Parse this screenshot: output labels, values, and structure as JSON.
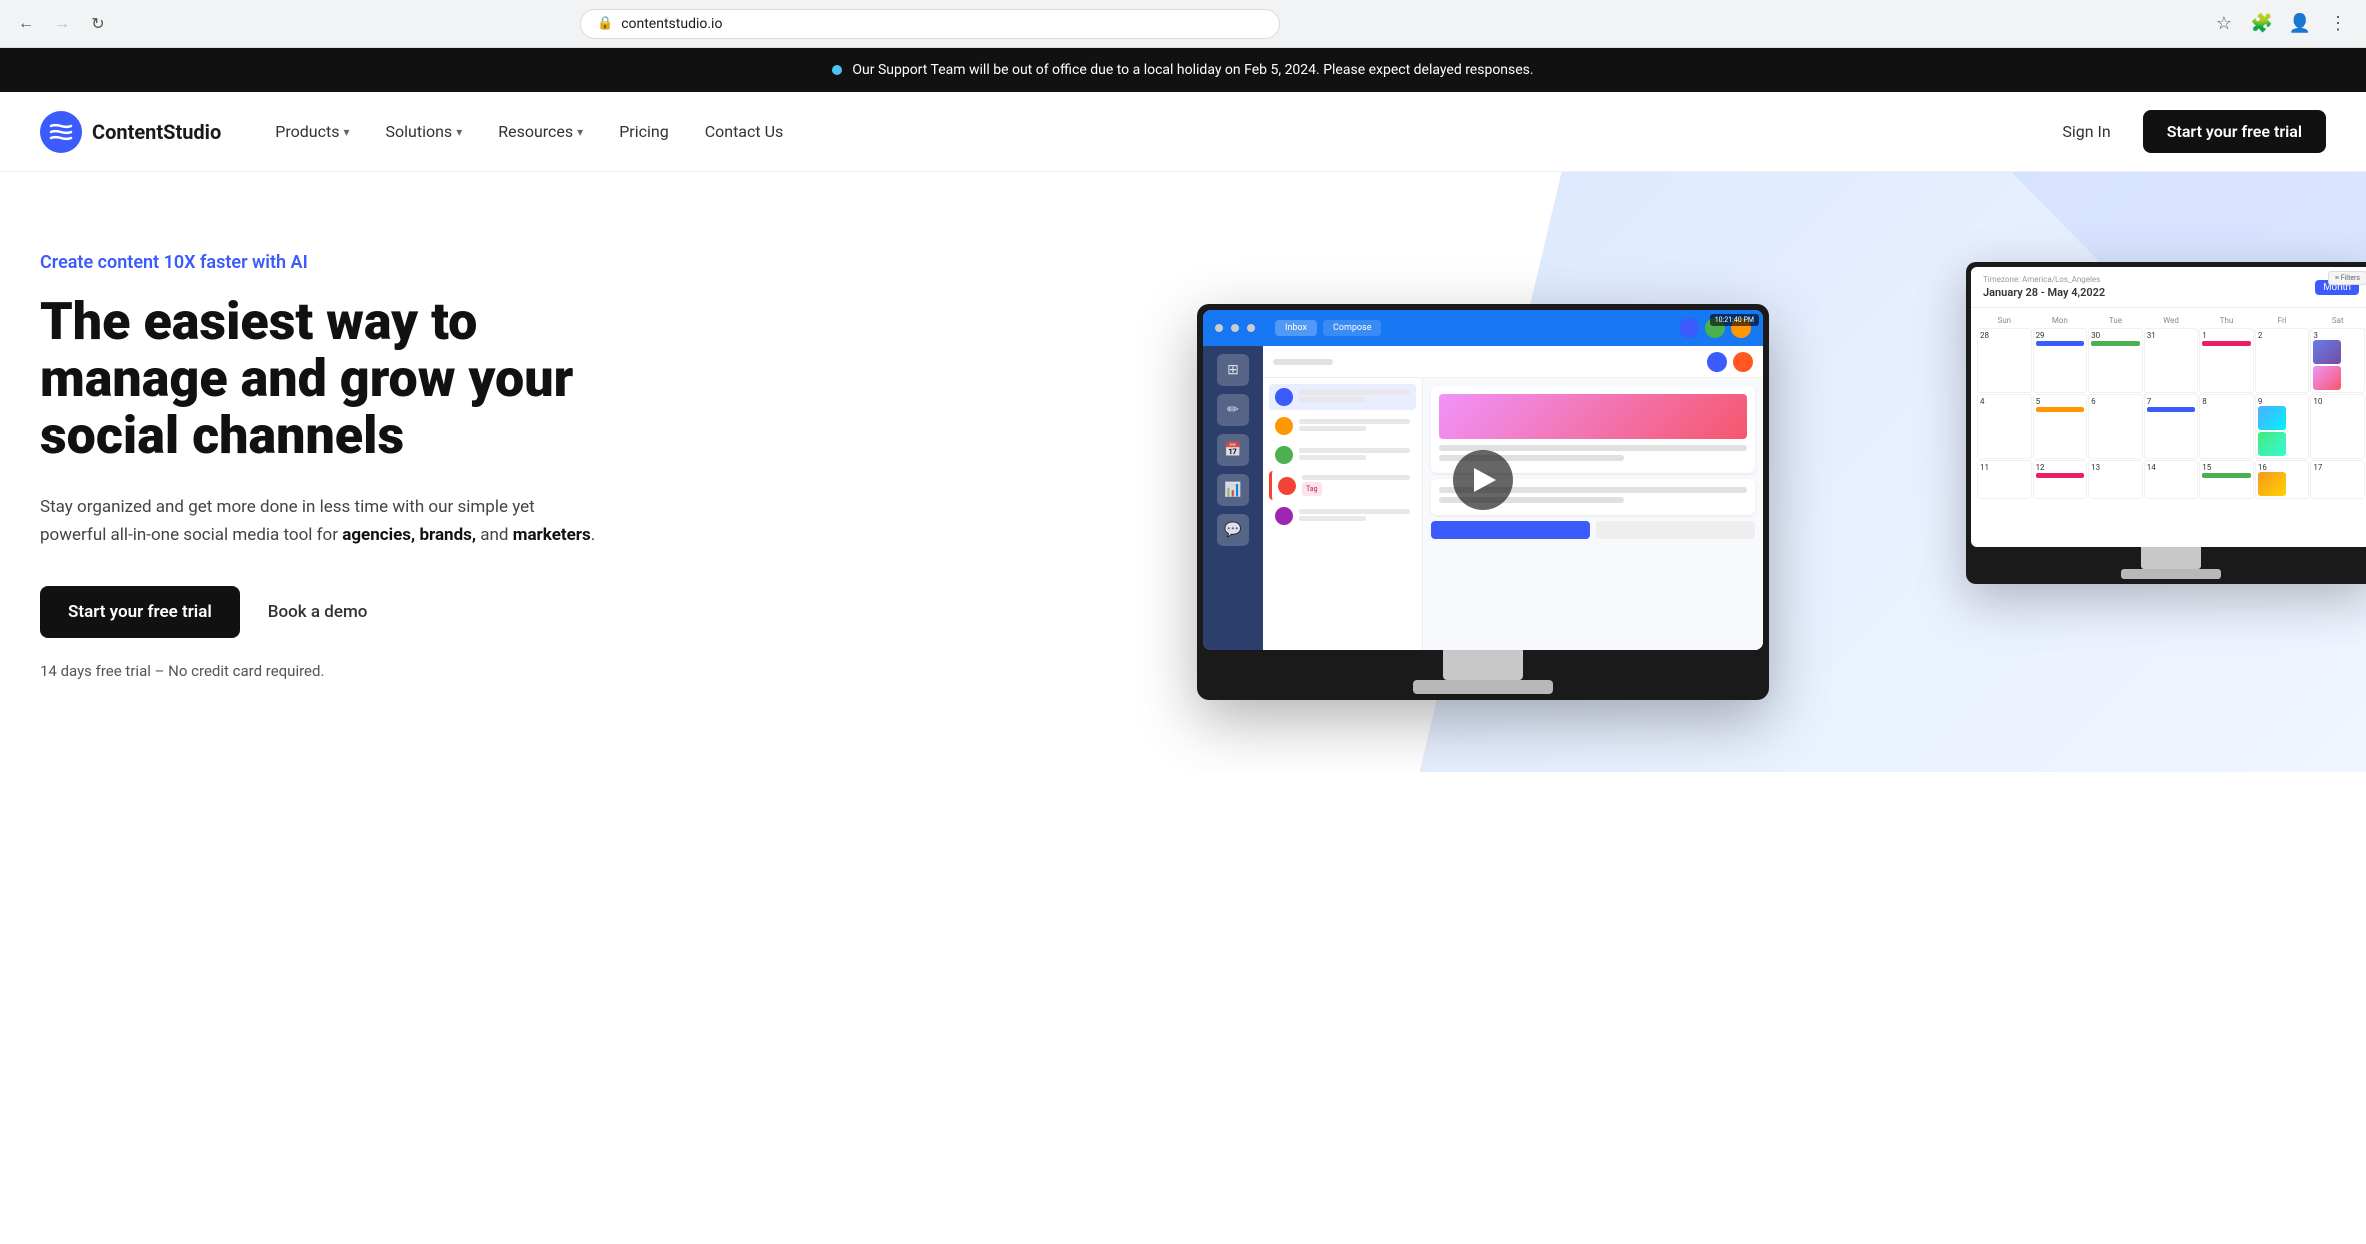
{
  "browser": {
    "url": "contentstudio.io",
    "back_disabled": false,
    "forward_disabled": true
  },
  "announcement": {
    "text": "Our Support Team will be out of office due to a local holiday on Feb 5, 2024. Please expect delayed responses."
  },
  "navbar": {
    "logo_text": "ContentStudio",
    "nav_items": [
      {
        "label": "Products",
        "has_dropdown": true
      },
      {
        "label": "Solutions",
        "has_dropdown": true
      },
      {
        "label": "Resources",
        "has_dropdown": true
      },
      {
        "label": "Pricing",
        "has_dropdown": false
      },
      {
        "label": "Contact Us",
        "has_dropdown": false
      }
    ],
    "sign_in_label": "Sign In",
    "trial_label": "Start your free trial"
  },
  "hero": {
    "tagline": "Create content 10X faster with AI",
    "title": "The easiest way to manage and grow your social channels",
    "description_part1": "Stay organized and get more done in less time with our simple yet powerful all-in-one social media tool for ",
    "description_bold1": "agencies,",
    "description_part2": " ",
    "description_bold2": "brands,",
    "description_part3": " and ",
    "description_bold3": "marketers",
    "description_end": ".",
    "cta_primary": "Start your free trial",
    "cta_secondary": "Book a demo",
    "note": "14 days free trial – No credit card required."
  },
  "mockup": {
    "calendar_title": "January 28 - May 4,2022",
    "month_label": "Month",
    "timestamp": "10:21:40 PM",
    "timezone": "Timezone: America/Los_Angeles",
    "day_headers": [
      "Sunday",
      "Monday",
      "Tuesday",
      "Wednesday",
      "Thursday",
      "Friday",
      "Saturday"
    ]
  }
}
